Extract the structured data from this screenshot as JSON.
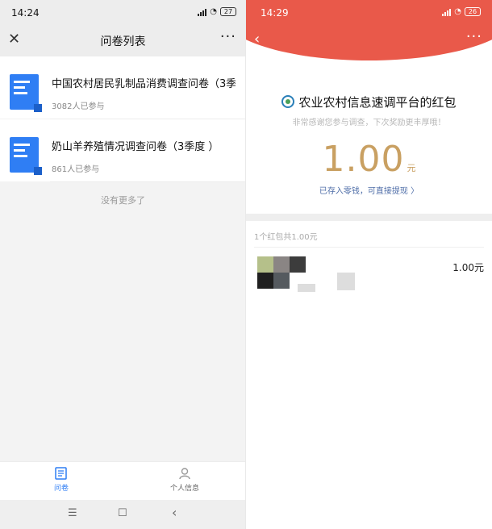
{
  "left": {
    "status": {
      "time": "14:24",
      "battery": "27"
    },
    "nav": {
      "close_icon": "close-icon",
      "title": "问卷列表",
      "more": "···"
    },
    "surveys": [
      {
        "name": "中国农村居民乳制品消费调查问卷（3季...",
        "participants": "3082人已参与"
      },
      {
        "name": "奶山羊养殖情况调查问卷（3季度 ）",
        "participants": "861人已参与"
      }
    ],
    "no_more": "没有更多了",
    "tabs": [
      {
        "label": "问卷",
        "icon": "survey-icon",
        "active": true
      },
      {
        "label": "个人信息",
        "icon": "person-icon",
        "active": false
      }
    ],
    "sysnav": {
      "menu": "☰",
      "home": "☐",
      "back": "‹"
    }
  },
  "right": {
    "status": {
      "time": "14:29",
      "battery": "26"
    },
    "nav": {
      "back": "‹",
      "more": "···"
    },
    "sender": "农业农村信息速调平台的红包",
    "thanks": "非常感谢您参与调查，下次奖励更丰厚哦！",
    "amount": "1.00",
    "unit": "元",
    "stored": "已存入零钱，可直接提现 〉",
    "summary": "1个红包共1.00元",
    "receiver_amount": "1.00元"
  },
  "colors": {
    "accent_blue": "#2f7ef4",
    "header_red": "#e9594a",
    "gold": "#c9a062",
    "link_blue": "#4f6ea8"
  }
}
